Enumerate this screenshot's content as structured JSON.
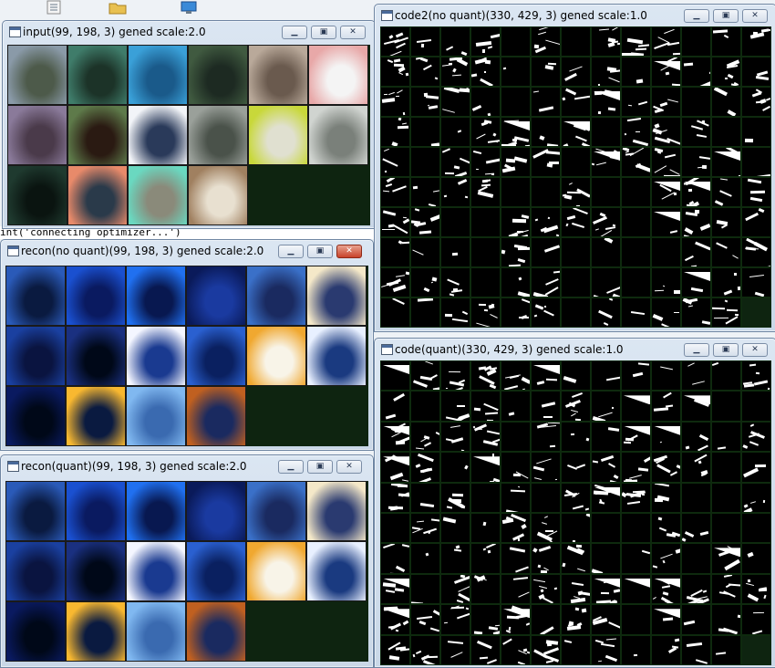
{
  "desktop": {
    "console_text": "int('connecting optimizer...')",
    "icons": [
      "document-icon",
      "folder-icon",
      "network-icon"
    ]
  },
  "windows": {
    "input": {
      "title": "input(99, 198, 3) gened scale:2.0",
      "controls": [
        "minimize",
        "maximize",
        "close"
      ]
    },
    "recon_no_quant": {
      "title": "recon(no quant)(99, 198, 3) gened scale:2.0",
      "controls": [
        "minimize",
        "maximize",
        "close"
      ]
    },
    "recon_quant": {
      "title": "recon(quant)(99, 198, 3) gened scale:2.0",
      "controls": [
        "minimize",
        "maximize",
        "close"
      ]
    },
    "code2_no_quant": {
      "title": "code2(no quant)(330, 429, 3) gened scale:1.0",
      "controls": [
        "minimize",
        "maximize",
        "close"
      ]
    },
    "code_quant": {
      "title": "code(quant)(330, 429, 3) gened scale:1.0",
      "controls": [
        "minimize",
        "maximize",
        "close"
      ]
    }
  },
  "colors": {
    "window_frame": "#c9d7e7",
    "client_bg": "#0e2410",
    "code_bg": "#000000",
    "close_active": "#c8422a"
  },
  "input_tiles": [
    {
      "name": "tile-boat",
      "c1": "#8a9aa8",
      "c2": "#4d5a4a"
    },
    {
      "name": "tile-frog-green",
      "c1": "#3f7c6a",
      "c2": "#1c3328"
    },
    {
      "name": "tile-blue-car",
      "c1": "#3aa0d8",
      "c2": "#1a5a8a"
    },
    {
      "name": "tile-frog-dark",
      "c1": "#405a40",
      "c2": "#1d2a22"
    },
    {
      "name": "tile-truck",
      "c1": "#b9a99a",
      "c2": "#6a5a4e"
    },
    {
      "name": "tile-horse-pink",
      "c1": "#e8a8a8",
      "c2": "#f4f4f4"
    },
    {
      "name": "tile-frog-purple",
      "c1": "#8a7a9a",
      "c2": "#4a3a4a"
    },
    {
      "name": "tile-horse-brown",
      "c1": "#5e7a4a",
      "c2": "#2a1a12"
    },
    {
      "name": "tile-cat-sketch",
      "c1": "#f2f4f8",
      "c2": "#2a3a5a"
    },
    {
      "name": "tile-frog-grey",
      "c1": "#9aa09a",
      "c2": "#4a524a"
    },
    {
      "name": "tile-truck-yellow",
      "c1": "#c8d83a",
      "c2": "#e0e0d0"
    },
    {
      "name": "tile-truck-grey",
      "c1": "#d0d4d0",
      "c2": "#7a807a"
    },
    {
      "name": "tile-deer",
      "c1": "#1f3a2f",
      "c2": "#0a1410"
    },
    {
      "name": "tile-bird",
      "c1": "#e88a6a",
      "c2": "#2a3a4a"
    },
    {
      "name": "tile-cat-tabby",
      "c1": "#6ad8c0",
      "c2": "#8a8a7a"
    },
    {
      "name": "tile-bird-owl",
      "c1": "#a08060",
      "c2": "#e8e0d0"
    }
  ],
  "recon_tiles": [
    {
      "name": "tile-boat",
      "c1": "#2a5ab8",
      "c2": "#0a1a40"
    },
    {
      "name": "tile-frog-green",
      "c1": "#1a50d0",
      "c2": "#0a1a60"
    },
    {
      "name": "tile-blue-car",
      "c1": "#2070f0",
      "c2": "#081850"
    },
    {
      "name": "tile-frog-dark",
      "c1": "#0a1a5a",
      "c2": "#1a3aa0"
    },
    {
      "name": "tile-truck",
      "c1": "#3a70c8",
      "c2": "#1a2a60"
    },
    {
      "name": "tile-horse-pink",
      "c1": "#f4e8c8",
      "c2": "#2a3a70"
    },
    {
      "name": "tile-frog-purple",
      "c1": "#1a40a0",
      "c2": "#0a1440"
    },
    {
      "name": "tile-horse-brown",
      "c1": "#1a3080",
      "c2": "#000818"
    },
    {
      "name": "tile-cat-sketch",
      "c1": "#f4f6ff",
      "c2": "#1a3a90"
    },
    {
      "name": "tile-frog-grey",
      "c1": "#2a60d0",
      "c2": "#0a2060"
    },
    {
      "name": "tile-truck-yellow",
      "c1": "#f0a830",
      "c2": "#f8f4e8"
    },
    {
      "name": "tile-truck-grey",
      "c1": "#e8f0ff",
      "c2": "#1a3a80"
    },
    {
      "name": "tile-deer",
      "c1": "#0a1a60",
      "c2": "#000818"
    },
    {
      "name": "tile-bird",
      "c1": "#f8b830",
      "c2": "#0a1a40"
    },
    {
      "name": "tile-cat-tabby",
      "c1": "#80b8f0",
      "c2": "#3a6ab0"
    },
    {
      "name": "tile-bird-owl",
      "c1": "#c06020",
      "c2": "#1a2a60"
    }
  ],
  "code_grid": {
    "cols": 13,
    "rows": 10,
    "filled_cells": 129
  }
}
